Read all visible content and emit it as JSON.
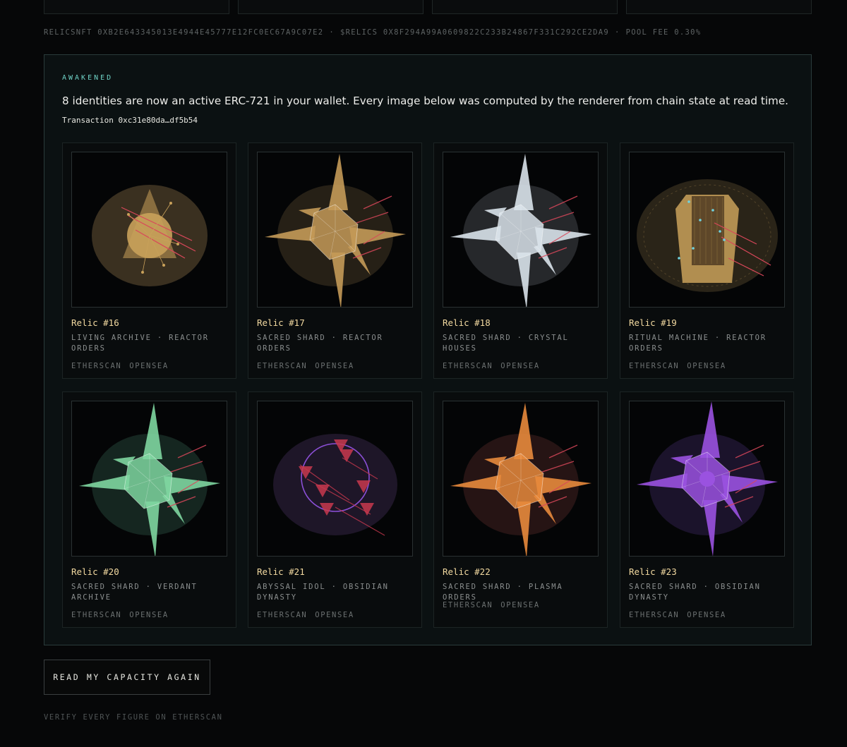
{
  "contracts": {
    "nft_label": "RELICSNFT 0XB2E643345013E4944E45777E12FC0EC67A9C07E2",
    "token_label": "$RELICS 0X8F294A99A0609822C233B24867F331C292CE2DA9",
    "fee_label": "POOL FEE 0.30%",
    "separator": "·"
  },
  "panel": {
    "eyebrow": "AWAKENED",
    "headline": "8 identities are now an active ERC-721 in your wallet. Every image below was computed by the renderer from chain state at read time.",
    "transaction_label": "Transaction 0xc31e80da…df5b54"
  },
  "relics": [
    {
      "name": "Relic #16",
      "traits": "LIVING ARCHIVE · REACTOR ORDERS",
      "etherscan": "ETHERSCAN",
      "opensea": "OPENSEA",
      "palette": {
        "primary": "#c9a15a",
        "halo": "#3a3020",
        "accent": "#d9475a"
      },
      "art": "archive"
    },
    {
      "name": "Relic #17",
      "traits": "SACRED SHARD · REACTOR ORDERS",
      "etherscan": "ETHERSCAN",
      "opensea": "OPENSEA",
      "palette": {
        "primary": "#c49a58",
        "halo": "#2a2318",
        "accent": "#d9475a"
      },
      "art": "shard"
    },
    {
      "name": "Relic #18",
      "traits": "SACRED SHARD · CRYSTAL HOUSES",
      "etherscan": "ETHERSCAN",
      "opensea": "OPENSEA",
      "palette": {
        "primary": "#d9e2ea",
        "halo": "#2a2c30",
        "accent": "#d9475a"
      },
      "art": "shard"
    },
    {
      "name": "Relic #19",
      "traits": "RITUAL MACHINE · REACTOR ORDERS",
      "etherscan": "ETHERSCAN",
      "opensea": "OPENSEA",
      "palette": {
        "primary": "#c9a15a",
        "halo": "#2a2418",
        "accent": "#d9475a"
      },
      "art": "machine"
    },
    {
      "name": "Relic #20",
      "traits": "SACRED SHARD · VERDANT ARCHIVE",
      "etherscan": "ETHERSCAN",
      "opensea": "OPENSEA",
      "palette": {
        "primary": "#7ed6a0",
        "halo": "#172a24",
        "accent": "#d9475a"
      },
      "art": "shard"
    },
    {
      "name": "Relic #21",
      "traits": "ABYSSAL IDOL · OBSIDIAN DYNASTY",
      "etherscan": "ETHERSCAN",
      "opensea": "OPENSEA",
      "palette": {
        "primary": "#8b4fd6",
        "halo": "#1e1628",
        "accent": "#c8384e"
      },
      "art": "idol"
    },
    {
      "name": "Relic #22",
      "traits": "SACRED SHARD · PLASMA ORDERS",
      "etherscan": "ETHERSCAN",
      "opensea": "OPENSEA",
      "palette": {
        "primary": "#e88a3c",
        "halo": "#2a1616",
        "accent": "#d9475a"
      },
      "art": "shard"
    },
    {
      "name": "Relic #23",
      "traits": "SACRED SHARD · OBSIDIAN DYNASTY",
      "etherscan": "ETHERSCAN",
      "opensea": "OPENSEA",
      "palette": {
        "primary": "#9a52e0",
        "halo": "#1e1530",
        "accent": "#d9475a"
      },
      "art": "orb-shard"
    }
  ],
  "actions": {
    "read_again": "READ MY CAPACITY AGAIN",
    "verify": "VERIFY EVERY FIGURE ON ETHERSCAN"
  }
}
